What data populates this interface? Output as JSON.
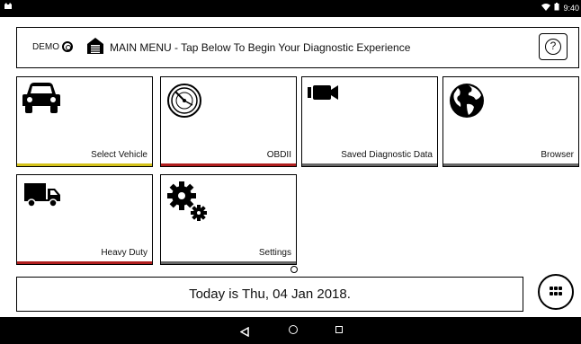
{
  "status_bar": {
    "time": "9:40",
    "left_icon": "android-cat-icon",
    "wifi_icon": "wifi-icon",
    "battery_icon": "battery-icon"
  },
  "header": {
    "demo_label": "DEMO",
    "title": "MAIN MENU - Tap Below To Begin Your Diagnostic Experience",
    "help_symbol": "?"
  },
  "tiles": [
    {
      "label": "Select Vehicle",
      "icon": "car-icon",
      "accent": "#d4c21a"
    },
    {
      "label": "OBDII",
      "icon": "gauge-icon",
      "accent": "#b01e1e"
    },
    {
      "label": "Saved Diagnostic Data",
      "icon": "video-camera-icon",
      "accent": "#666666"
    },
    {
      "label": "Browser",
      "icon": "globe-icon",
      "accent": "#666666"
    },
    {
      "label": "Heavy Duty",
      "icon": "truck-icon",
      "accent": "#b01e1e"
    },
    {
      "label": "Settings",
      "icon": "gears-icon",
      "accent": "#666666"
    }
  ],
  "footer": {
    "date_text": "Today is Thu, 04 Jan 2018."
  },
  "colors": {
    "yellow_accent": "#d4c21a",
    "red_accent": "#b01e1e",
    "gray_accent": "#666666"
  }
}
